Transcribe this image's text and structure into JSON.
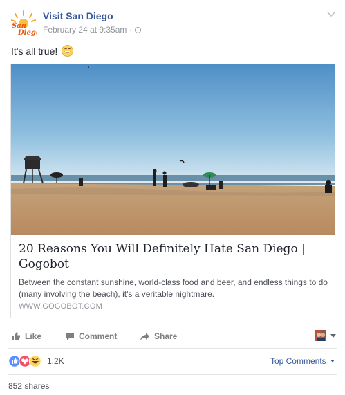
{
  "post": {
    "page_name": "Visit San Diego",
    "logo_text": "San Diego",
    "timestamp": "February 24 at 9:35am",
    "meta_separator": "·",
    "privacy_icon": "globe-icon",
    "text": "It's all true!",
    "emoji_icon": "grinning-sweat-emoji"
  },
  "link_card": {
    "title": "20 Reasons You Will Definitely Hate San Diego | Gogobot",
    "description": "Between the constant sunshine, world-class food and beer, and endless things to do (many involving the beach), it's a veritable nightmare.",
    "domain": "WWW.GOGOBOT.COM",
    "image_icon": "beach-photo"
  },
  "actions": {
    "like_label": "Like",
    "comment_label": "Comment",
    "share_label": "Share"
  },
  "reactions": {
    "icons": [
      "like-reaction-icon",
      "love-reaction-icon",
      "haha-reaction-icon"
    ],
    "count": "1.2K",
    "top_comments_label": "Top Comments"
  },
  "shares_label": "852 shares",
  "colors": {
    "link_blue": "#365899",
    "meta_gray": "#90949c",
    "like_blue": "#5890ff",
    "love_red": "#f25268",
    "haha_yellow": "#fcd462"
  }
}
